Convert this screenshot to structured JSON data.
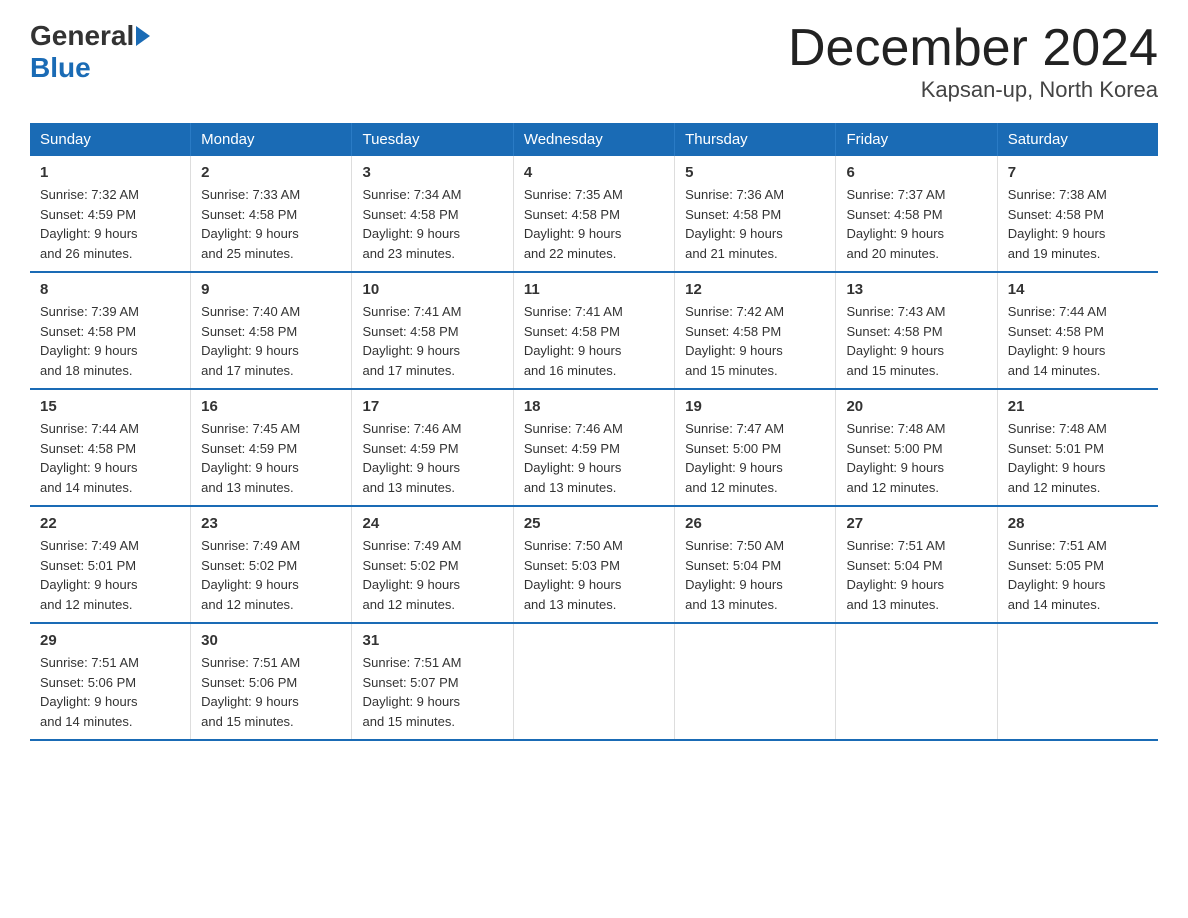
{
  "logo": {
    "general": "General",
    "blue": "Blue"
  },
  "title": "December 2024",
  "subtitle": "Kapsan-up, North Korea",
  "weekdays": [
    "Sunday",
    "Monday",
    "Tuesday",
    "Wednesday",
    "Thursday",
    "Friday",
    "Saturday"
  ],
  "weeks": [
    [
      {
        "day": "1",
        "info": "Sunrise: 7:32 AM\nSunset: 4:59 PM\nDaylight: 9 hours\nand 26 minutes."
      },
      {
        "day": "2",
        "info": "Sunrise: 7:33 AM\nSunset: 4:58 PM\nDaylight: 9 hours\nand 25 minutes."
      },
      {
        "day": "3",
        "info": "Sunrise: 7:34 AM\nSunset: 4:58 PM\nDaylight: 9 hours\nand 23 minutes."
      },
      {
        "day": "4",
        "info": "Sunrise: 7:35 AM\nSunset: 4:58 PM\nDaylight: 9 hours\nand 22 minutes."
      },
      {
        "day": "5",
        "info": "Sunrise: 7:36 AM\nSunset: 4:58 PM\nDaylight: 9 hours\nand 21 minutes."
      },
      {
        "day": "6",
        "info": "Sunrise: 7:37 AM\nSunset: 4:58 PM\nDaylight: 9 hours\nand 20 minutes."
      },
      {
        "day": "7",
        "info": "Sunrise: 7:38 AM\nSunset: 4:58 PM\nDaylight: 9 hours\nand 19 minutes."
      }
    ],
    [
      {
        "day": "8",
        "info": "Sunrise: 7:39 AM\nSunset: 4:58 PM\nDaylight: 9 hours\nand 18 minutes."
      },
      {
        "day": "9",
        "info": "Sunrise: 7:40 AM\nSunset: 4:58 PM\nDaylight: 9 hours\nand 17 minutes."
      },
      {
        "day": "10",
        "info": "Sunrise: 7:41 AM\nSunset: 4:58 PM\nDaylight: 9 hours\nand 17 minutes."
      },
      {
        "day": "11",
        "info": "Sunrise: 7:41 AM\nSunset: 4:58 PM\nDaylight: 9 hours\nand 16 minutes."
      },
      {
        "day": "12",
        "info": "Sunrise: 7:42 AM\nSunset: 4:58 PM\nDaylight: 9 hours\nand 15 minutes."
      },
      {
        "day": "13",
        "info": "Sunrise: 7:43 AM\nSunset: 4:58 PM\nDaylight: 9 hours\nand 15 minutes."
      },
      {
        "day": "14",
        "info": "Sunrise: 7:44 AM\nSunset: 4:58 PM\nDaylight: 9 hours\nand 14 minutes."
      }
    ],
    [
      {
        "day": "15",
        "info": "Sunrise: 7:44 AM\nSunset: 4:58 PM\nDaylight: 9 hours\nand 14 minutes."
      },
      {
        "day": "16",
        "info": "Sunrise: 7:45 AM\nSunset: 4:59 PM\nDaylight: 9 hours\nand 13 minutes."
      },
      {
        "day": "17",
        "info": "Sunrise: 7:46 AM\nSunset: 4:59 PM\nDaylight: 9 hours\nand 13 minutes."
      },
      {
        "day": "18",
        "info": "Sunrise: 7:46 AM\nSunset: 4:59 PM\nDaylight: 9 hours\nand 13 minutes."
      },
      {
        "day": "19",
        "info": "Sunrise: 7:47 AM\nSunset: 5:00 PM\nDaylight: 9 hours\nand 12 minutes."
      },
      {
        "day": "20",
        "info": "Sunrise: 7:48 AM\nSunset: 5:00 PM\nDaylight: 9 hours\nand 12 minutes."
      },
      {
        "day": "21",
        "info": "Sunrise: 7:48 AM\nSunset: 5:01 PM\nDaylight: 9 hours\nand 12 minutes."
      }
    ],
    [
      {
        "day": "22",
        "info": "Sunrise: 7:49 AM\nSunset: 5:01 PM\nDaylight: 9 hours\nand 12 minutes."
      },
      {
        "day": "23",
        "info": "Sunrise: 7:49 AM\nSunset: 5:02 PM\nDaylight: 9 hours\nand 12 minutes."
      },
      {
        "day": "24",
        "info": "Sunrise: 7:49 AM\nSunset: 5:02 PM\nDaylight: 9 hours\nand 12 minutes."
      },
      {
        "day": "25",
        "info": "Sunrise: 7:50 AM\nSunset: 5:03 PM\nDaylight: 9 hours\nand 13 minutes."
      },
      {
        "day": "26",
        "info": "Sunrise: 7:50 AM\nSunset: 5:04 PM\nDaylight: 9 hours\nand 13 minutes."
      },
      {
        "day": "27",
        "info": "Sunrise: 7:51 AM\nSunset: 5:04 PM\nDaylight: 9 hours\nand 13 minutes."
      },
      {
        "day": "28",
        "info": "Sunrise: 7:51 AM\nSunset: 5:05 PM\nDaylight: 9 hours\nand 14 minutes."
      }
    ],
    [
      {
        "day": "29",
        "info": "Sunrise: 7:51 AM\nSunset: 5:06 PM\nDaylight: 9 hours\nand 14 minutes."
      },
      {
        "day": "30",
        "info": "Sunrise: 7:51 AM\nSunset: 5:06 PM\nDaylight: 9 hours\nand 15 minutes."
      },
      {
        "day": "31",
        "info": "Sunrise: 7:51 AM\nSunset: 5:07 PM\nDaylight: 9 hours\nand 15 minutes."
      },
      {
        "day": "",
        "info": ""
      },
      {
        "day": "",
        "info": ""
      },
      {
        "day": "",
        "info": ""
      },
      {
        "day": "",
        "info": ""
      }
    ]
  ]
}
